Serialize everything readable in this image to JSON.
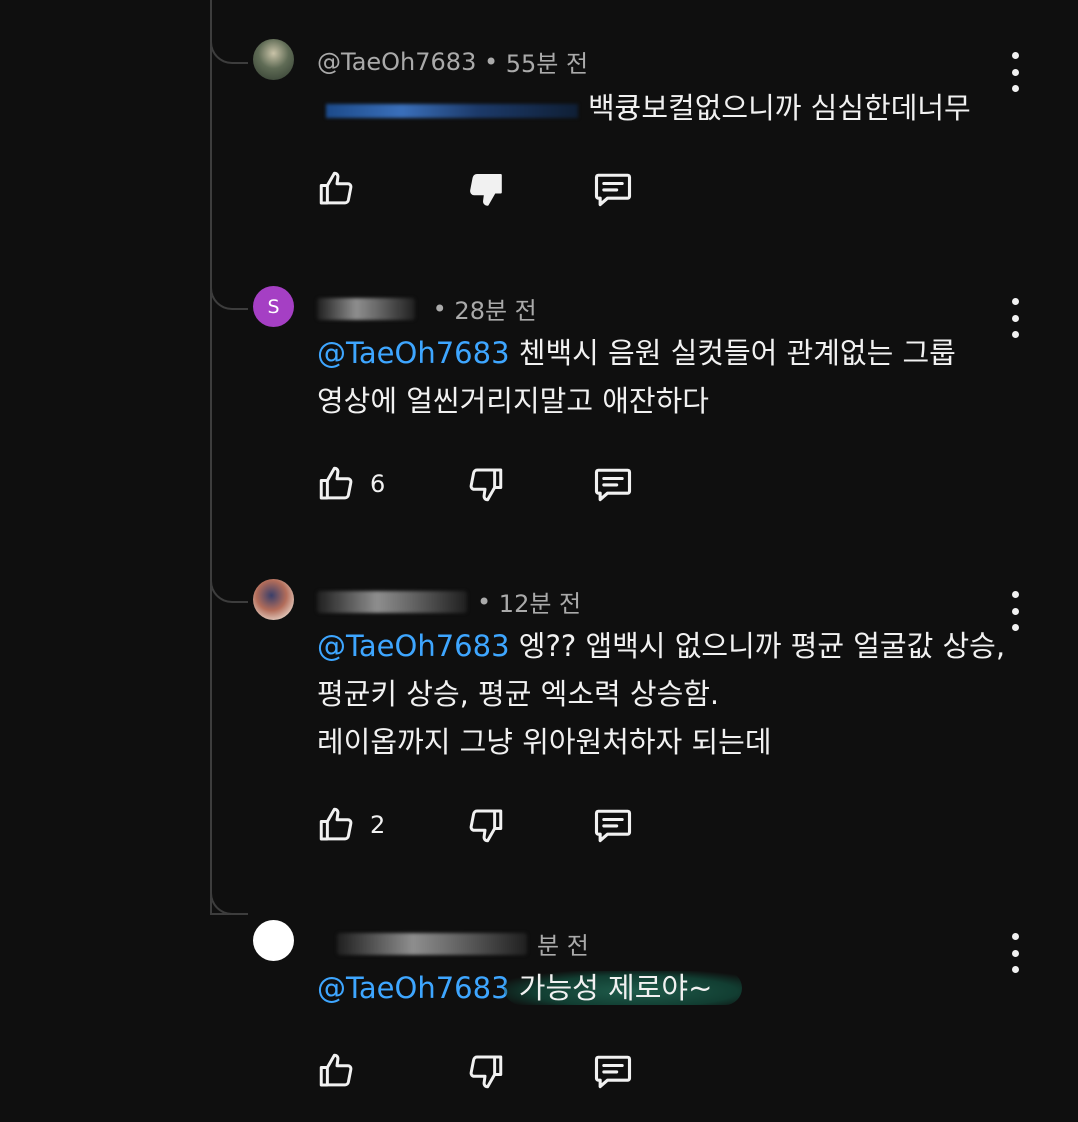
{
  "comments": [
    {
      "author": "@TaeOh7683",
      "time": "55분 전",
      "text": "백큥보컬없으니까 심심한데너무",
      "likes": "",
      "disliked": true
    },
    {
      "avatar_letter": "S",
      "time": "28분 전",
      "mention": "@TaeOh7683",
      "line1": " 첸백시 음원 실컷들어 관계없는 그룹",
      "line2": "영상에 얼씬거리지말고 애잔하다",
      "likes": "6"
    },
    {
      "time": "12분 전",
      "mention": "@TaeOh7683",
      "line1": " 엥?? 앱백시 없으니까 평균 얼굴값 상승,",
      "line2": "평균키 상승, 평균 엑소력 상승함.",
      "line3": "레이옵까지 그냥 위아원처하자 되는데",
      "likes": "2"
    },
    {
      "time": "분 전",
      "mention": "@TaeOh7683",
      "line1": " 가능성 제로야~",
      "likes": ""
    }
  ],
  "icons": {
    "like": "thumbs-up-icon",
    "dislike": "thumbs-down-icon",
    "reply": "reply-icon",
    "more": "more-vert-icon"
  }
}
